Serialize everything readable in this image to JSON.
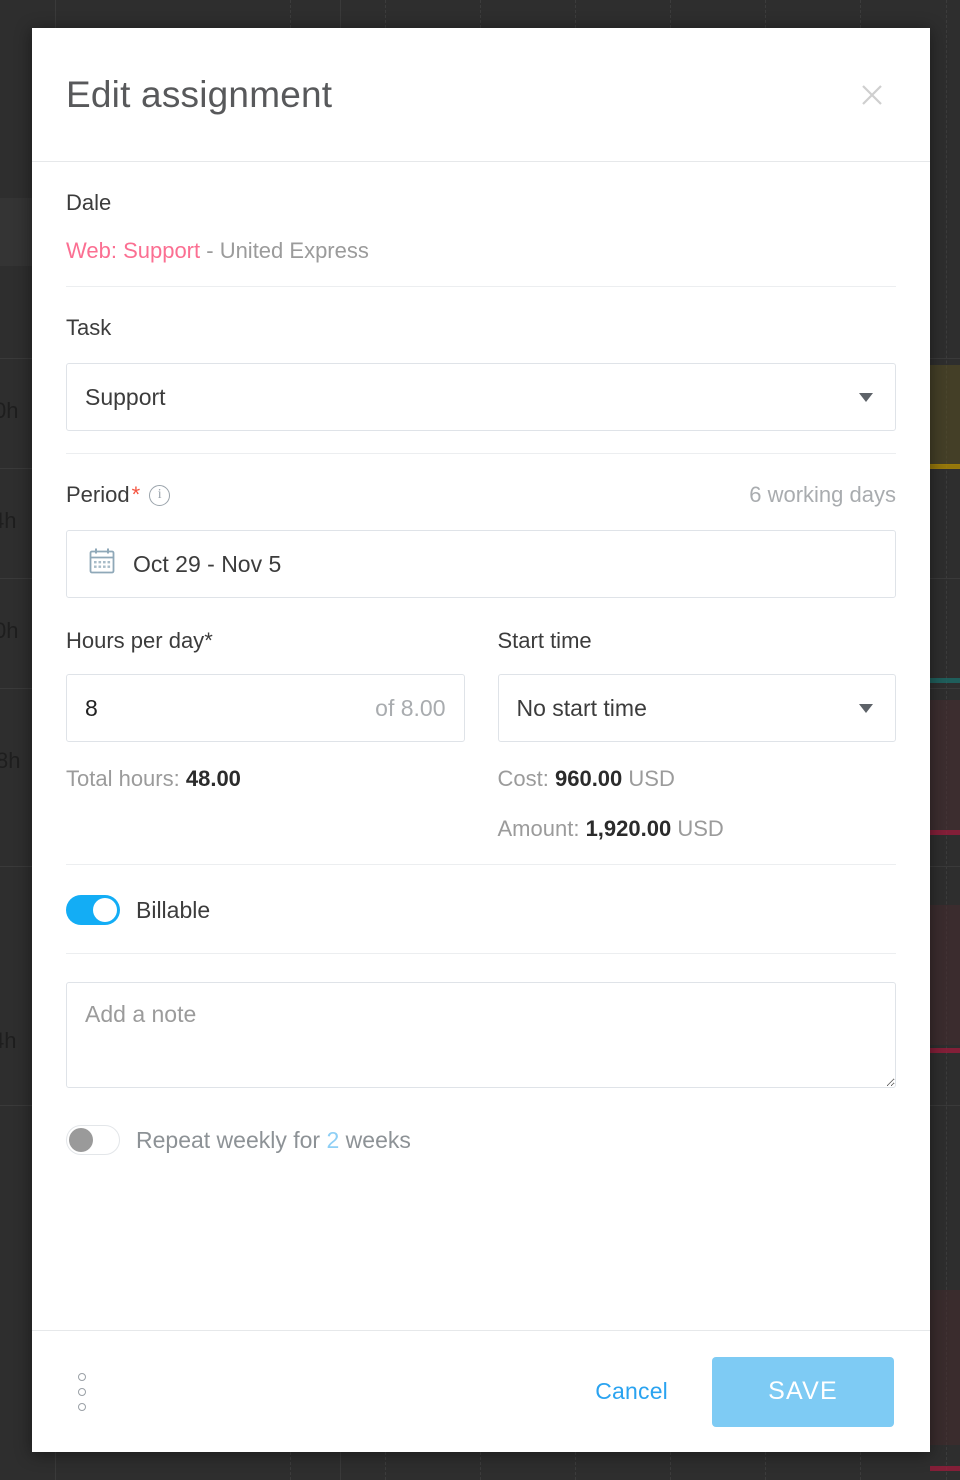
{
  "modal": {
    "title": "Edit assignment",
    "close_icon": "close-icon"
  },
  "assignment": {
    "person": "Dale",
    "project_task": "Web: Support",
    "project_separator": " - ",
    "client": "United Express"
  },
  "task": {
    "label": "Task",
    "selected": "Support"
  },
  "period": {
    "label": "Period",
    "required_mark": "*",
    "info_icon": "info-icon",
    "working_days": "6 working days",
    "calendar_icon": "calendar-icon",
    "range": "Oct 29 - Nov 5"
  },
  "hours_per_day": {
    "label": "Hours per day",
    "required_mark": "*",
    "value": "8",
    "hint": "of 8.00"
  },
  "start_time": {
    "label": "Start time",
    "selected": "No start time"
  },
  "totals": {
    "total_hours_label": "Total hours:",
    "total_hours_value": "48.00",
    "cost_label": "Cost:",
    "cost_value": "960.00",
    "cost_currency": "USD",
    "amount_label": "Amount:",
    "amount_value": "1,920.00",
    "amount_currency": "USD"
  },
  "billable": {
    "label": "Billable",
    "enabled": true
  },
  "note": {
    "placeholder": "Add a note",
    "value": ""
  },
  "repeat": {
    "enabled": false,
    "prefix": "Repeat weekly for",
    "count": "2",
    "suffix": "weeks"
  },
  "footer": {
    "more_icon": "more-vertical-icon",
    "cancel_label": "Cancel",
    "save_label": "SAVE"
  },
  "colors": {
    "accent_blue": "#13adf5",
    "save_blue": "#7ecbf4",
    "link_blue": "#2aa3f0",
    "task_pink": "#fb6f92",
    "required_red": "#f4533f",
    "overlay_dark": "#2e2e2e"
  }
}
